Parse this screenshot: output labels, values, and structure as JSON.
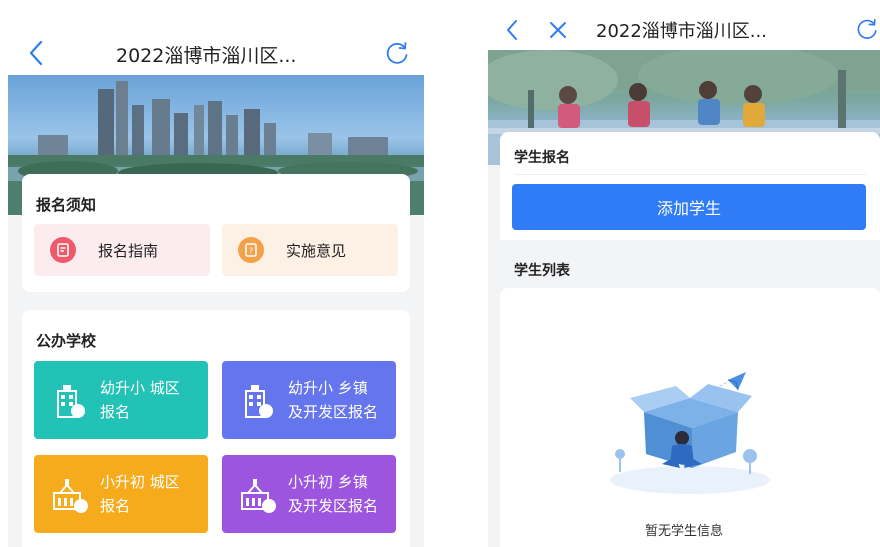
{
  "left_screen": {
    "header": {
      "title": "2022淄博市淄川区..."
    },
    "notice_card": {
      "title": "报名须知",
      "buttons": [
        {
          "label": "报名指南",
          "bg": "#fdecef",
          "icon_color": "#ef5a6b",
          "icon": "document-icon"
        },
        {
          "label": "实施意见",
          "bg": "#fdf0e4",
          "icon_color": "#f5a14a",
          "icon": "document-question-icon"
        }
      ]
    },
    "public_schools": {
      "title": "公办学校",
      "tiles": [
        {
          "line1": "幼升小 城区",
          "line2": "报名",
          "color": "#22c2b6",
          "icon": "school-city-icon"
        },
        {
          "line1": "幼升小 乡镇",
          "line2": "及开发区报名",
          "color": "#6575ee",
          "icon": "school-town-icon"
        },
        {
          "line1": "小升初 城区",
          "line2": "报名",
          "color": "#f6ab1d",
          "icon": "building-city-icon"
        },
        {
          "line1": "小升初 乡镇",
          "line2": "及开发区报名",
          "color": "#9d55e0",
          "icon": "building-town-icon"
        }
      ]
    }
  },
  "right_screen": {
    "header": {
      "title": "2022淄博市淄川区..."
    },
    "student_signup": {
      "title": "学生报名",
      "add_button": "添加学生"
    },
    "student_list": {
      "title": "学生列表",
      "empty_text": "暂无学生信息"
    }
  },
  "colors": {
    "accent_blue": "#2f7cf6",
    "nav_icon_blue": "#2f7cf6"
  }
}
